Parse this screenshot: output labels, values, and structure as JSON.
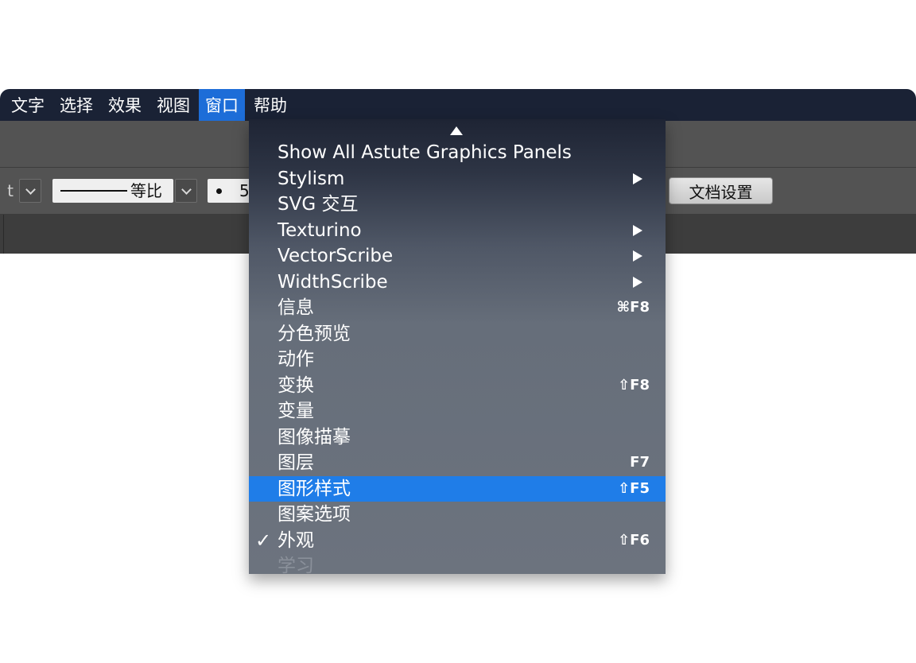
{
  "menubar": {
    "items": [
      {
        "label": "文字",
        "active": false
      },
      {
        "label": "选择",
        "active": false
      },
      {
        "label": "效果",
        "active": false
      },
      {
        "label": "视图",
        "active": false
      },
      {
        "label": "窗口",
        "active": true
      },
      {
        "label": "帮助",
        "active": false
      }
    ]
  },
  "control_bar": {
    "cut_text": "t",
    "stroke_profile_label": "等比",
    "brush_size_label": "5",
    "doc_settings_label": "文档设置"
  },
  "window_menu": {
    "scroll_indicator": "scroll-up-arrow",
    "items": [
      {
        "label": "Show All Astute Graphics Panels",
        "shortcut": "",
        "submenu": false,
        "checked": false,
        "highlighted": false,
        "disabled": false
      },
      {
        "label": "Stylism",
        "shortcut": "",
        "submenu": true,
        "checked": false,
        "highlighted": false,
        "disabled": false
      },
      {
        "label": "SVG 交互",
        "shortcut": "",
        "submenu": false,
        "checked": false,
        "highlighted": false,
        "disabled": false
      },
      {
        "label": "Texturino",
        "shortcut": "",
        "submenu": true,
        "checked": false,
        "highlighted": false,
        "disabled": false
      },
      {
        "label": "VectorScribe",
        "shortcut": "",
        "submenu": true,
        "checked": false,
        "highlighted": false,
        "disabled": false
      },
      {
        "label": "WidthScribe",
        "shortcut": "",
        "submenu": true,
        "checked": false,
        "highlighted": false,
        "disabled": false
      },
      {
        "label": "信息",
        "shortcut": "⌘F8",
        "submenu": false,
        "checked": false,
        "highlighted": false,
        "disabled": false
      },
      {
        "label": "分色预览",
        "shortcut": "",
        "submenu": false,
        "checked": false,
        "highlighted": false,
        "disabled": false
      },
      {
        "label": "动作",
        "shortcut": "",
        "submenu": false,
        "checked": false,
        "highlighted": false,
        "disabled": false
      },
      {
        "label": "变换",
        "shortcut": "⇧F8",
        "submenu": false,
        "checked": false,
        "highlighted": false,
        "disabled": false
      },
      {
        "label": "变量",
        "shortcut": "",
        "submenu": false,
        "checked": false,
        "highlighted": false,
        "disabled": false
      },
      {
        "label": "图像描摹",
        "shortcut": "",
        "submenu": false,
        "checked": false,
        "highlighted": false,
        "disabled": false
      },
      {
        "label": "图层",
        "shortcut": "F7",
        "submenu": false,
        "checked": false,
        "highlighted": false,
        "disabled": false
      },
      {
        "label": "图形样式",
        "shortcut": "⇧F5",
        "submenu": false,
        "checked": false,
        "highlighted": true,
        "disabled": false
      },
      {
        "label": "图案选项",
        "shortcut": "",
        "submenu": false,
        "checked": false,
        "highlighted": false,
        "disabled": false
      },
      {
        "label": "外观",
        "shortcut": "⇧F6",
        "submenu": false,
        "checked": true,
        "highlighted": false,
        "disabled": false
      },
      {
        "label": "学习",
        "shortcut": "",
        "submenu": false,
        "checked": false,
        "highlighted": false,
        "disabled": true
      }
    ]
  },
  "colors": {
    "menubar_bg": "#1a2235",
    "accent": "#1f7de8",
    "toolbar_bg": "#535353",
    "panel_bg": "#3d3d3d"
  }
}
